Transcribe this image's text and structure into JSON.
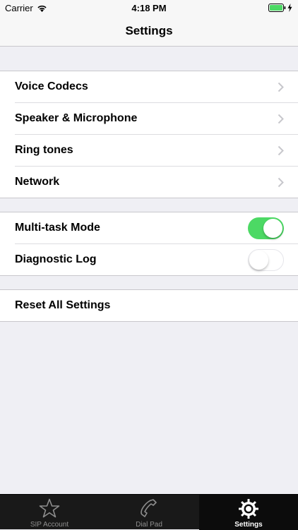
{
  "status_bar": {
    "carrier": "Carrier",
    "time": "4:18 PM"
  },
  "nav": {
    "title": "Settings"
  },
  "groups": {
    "navigation_rows": [
      {
        "label": "Voice Codecs"
      },
      {
        "label": "Speaker & Microphone"
      },
      {
        "label": "Ring tones"
      },
      {
        "label": "Network"
      }
    ],
    "toggle_rows": [
      {
        "label": "Multi-task Mode",
        "value": "on"
      },
      {
        "label": "Diagnostic Log",
        "value": "off"
      }
    ],
    "action_rows": [
      {
        "label": "Reset All Settings"
      }
    ]
  },
  "tab_bar": {
    "tabs": [
      {
        "label": "SIP Account",
        "icon": "star-icon"
      },
      {
        "label": "Dial Pad",
        "icon": "phone-icon"
      },
      {
        "label": "Settings",
        "icon": "gear-icon",
        "active": true
      }
    ]
  },
  "colors": {
    "toggle_on": "#4cd964",
    "background": "#efeff4",
    "tab_bar": "#191919"
  }
}
